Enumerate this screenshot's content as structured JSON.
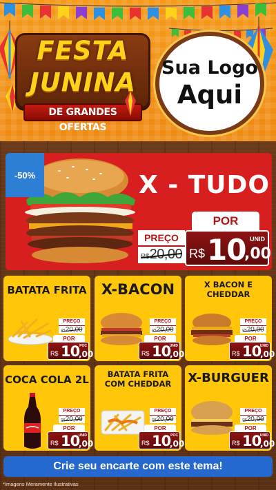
{
  "header": {
    "festa_line1": "FESTA",
    "festa_line2": "JUNINA",
    "subtitle": "DE GRANDES OFERTAS",
    "logo_line1": "Sua Logo",
    "logo_line2": "Aqui"
  },
  "hero": {
    "discount": "-50%",
    "title": "X - TUDO",
    "preco_label": "PREÇO",
    "old_currency": "R$",
    "old_price": "20,00",
    "por_label": "POR",
    "currency": "R$",
    "price_int": "10",
    "price_cents": ",00",
    "unit": "UNID"
  },
  "cards": [
    {
      "title": "BATATA FRITA",
      "preco_label": "PREÇO",
      "old_price": "20,00",
      "old_currency": "R$",
      "por_label": "POR",
      "currency": "R$",
      "price_int": "10",
      "price_cents": ",00",
      "unit": "POC"
    },
    {
      "title": "X-BACON",
      "preco_label": "PREÇO",
      "old_price": "20,00",
      "old_currency": "R$",
      "por_label": "POR",
      "currency": "R$",
      "price_int": "10",
      "price_cents": ",00",
      "unit": "UNID"
    },
    {
      "title": "X BACON E CHEDDAR",
      "preco_label": "PREÇO",
      "old_price": "20,00",
      "old_currency": "R$",
      "por_label": "POR",
      "currency": "R$",
      "price_int": "10",
      "price_cents": ",00",
      "unit": "UNID"
    },
    {
      "title": "COCA COLA 2L",
      "preco_label": "PREÇO",
      "old_price": "20,00",
      "old_currency": "R$",
      "por_label": "POR",
      "currency": "R$",
      "price_int": "10",
      "price_cents": ",00",
      "unit": "UNID"
    },
    {
      "title": "BATATA FRITA COM CHEDDAR",
      "preco_label": "PREÇO",
      "old_price": "20,00",
      "old_currency": "R$",
      "por_label": "POR",
      "currency": "R$",
      "price_int": "10",
      "price_cents": ",00",
      "unit": "POC"
    },
    {
      "title": "X-BURGUER",
      "preco_label": "PREÇO",
      "old_price": "20,00",
      "old_currency": "R$",
      "por_label": "POR",
      "currency": "R$",
      "price_int": "10",
      "price_cents": ",00",
      "unit": "UNID"
    }
  ],
  "cta": {
    "label": "Crie seu encarte com este tema!"
  },
  "footnote": "*Imagens Meramente Ilustrativas",
  "colors": {
    "header_orange": "#f59a1a",
    "hero_red": "#d71f1f",
    "card_yellow": "#ffc60a",
    "cta_blue": "#2468d0",
    "discount_blue": "#2d7fd6",
    "price_red": "#8f1313"
  }
}
